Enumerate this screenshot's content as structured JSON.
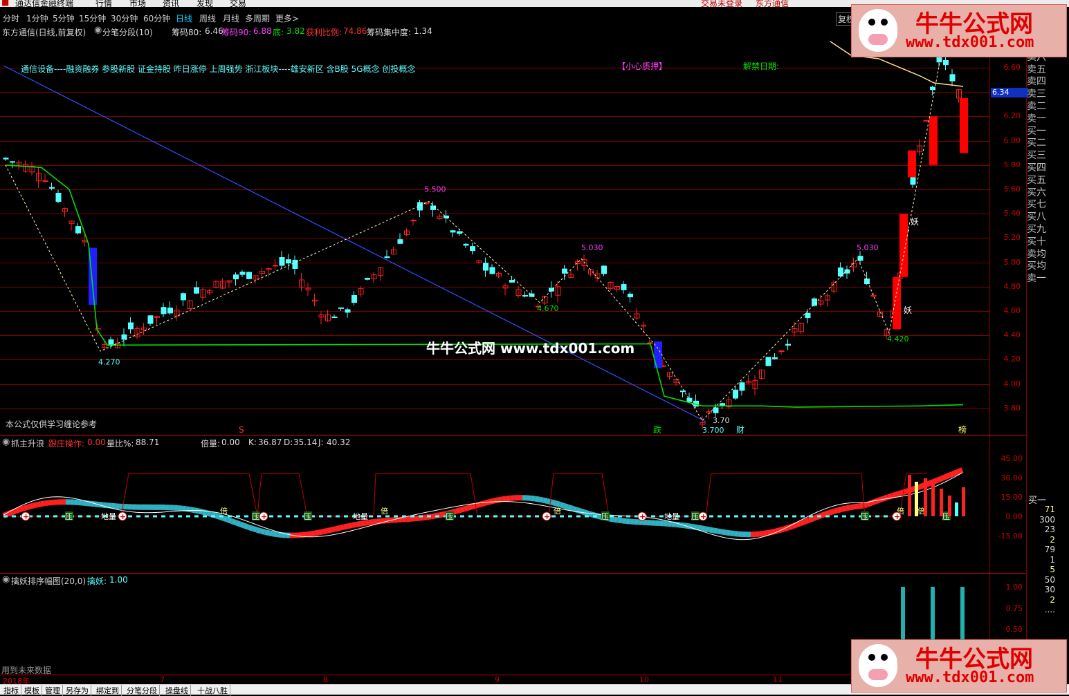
{
  "menu": {
    "app": "通达信金融终端",
    "items": [
      "行情",
      "市场",
      "资讯",
      "发现",
      "交易"
    ],
    "login": "交易未登录",
    "stock": "东方通信"
  },
  "periods": [
    "分时",
    "1分钟",
    "5分钟",
    "15分钟",
    "30分钟",
    "60分钟",
    "日线",
    "周线",
    "月线",
    "多周期",
    "更多>"
  ],
  "active_period": "日线",
  "restore_button": "复权",
  "main_panel": {
    "stock_title": "东方通信(日线,前复权)",
    "indicator_name": "分笔分段(10)",
    "chip80_label": "筹码80:",
    "chip80": "6.46",
    "chip90_label": "筹码90:",
    "chip90": "6.88",
    "bottom_label": "底:",
    "bottom": "3.82",
    "profit_label": "获利比例:",
    "profit": "74.86",
    "conc_label": "筹码集中度:",
    "conc": "1.34",
    "concepts": "通信设备----融资融券 参股新股 证金持股 昨日涨停 上周强势 浙江板块----雄安新区 含B股 5G概念 创投概念",
    "warning": "【小心质押】",
    "unlock": "解禁日期:",
    "note": "本公式仅供学习缠论参考",
    "watermark": "牛牛公式网 www.tdx001.com",
    "current_price": "6.34",
    "pivot_labels": [
      "4.270",
      "5.500",
      "4.670",
      "5.030",
      "3.70",
      "3.700",
      "5.030",
      "4.420"
    ],
    "markers": {
      "s": "S",
      "die": "跌",
      "cai": "财",
      "bang": "榜",
      "yao": "妖"
    }
  },
  "price_axis": [
    "6.60",
    "6.40",
    "6.20",
    "6.00",
    "5.80",
    "5.60",
    "5.40",
    "5.20",
    "5.00",
    "4.80",
    "4.60",
    "4.40",
    "4.20",
    "4.00",
    "3.80"
  ],
  "order_book": [
    "卖七",
    "卖六",
    "卖五",
    "卖四",
    "卖三",
    "卖二",
    "卖一",
    "买一",
    "买二",
    "买三",
    "买四",
    "买五",
    "买六",
    "买七",
    "买八",
    "买九",
    "买十",
    "卖均",
    "买均",
    "卖一"
  ],
  "mid_panel": {
    "title": "抓主升浪",
    "op_label": "跟庄操作:",
    "op": "0.00",
    "vol_label": "量比%:",
    "vol": "88.71",
    "bei_label": "倍量:",
    "bei": "0.00",
    "k_label": "K:",
    "k": "36.87",
    "d_label": "D:",
    "d": "35.14",
    "j_label": "J:",
    "j": "40.32",
    "axis": [
      "45.00",
      "30.00",
      "15.00",
      "0.00",
      "-15.00"
    ],
    "tags": {
      "ya": "压",
      "bei": "倍",
      "dl": "地量"
    },
    "buy1": "买一",
    "ticks": [
      "71",
      "300",
      "23",
      "2",
      "79",
      "1",
      "5",
      "50",
      "30",
      "2",
      "...."
    ]
  },
  "low_panel": {
    "title": "擒妖排序幅图(20,0)",
    "val_label": "擒妖:",
    "val": "1.00",
    "axis": [
      "1.00",
      "0.75",
      "0.50"
    ]
  },
  "future_note": "用到未来数据",
  "date_axis": [
    "2018年",
    "7",
    "8",
    "9",
    "10",
    "11"
  ],
  "bottom_tabs": [
    "指标",
    "模板",
    "管理",
    "另存为",
    "绑定到",
    "分笔分段",
    "操盘线",
    "十战八胜"
  ],
  "logo": {
    "cn": "牛牛公式网",
    "url": "www.tdx001.com"
  },
  "colors": {
    "up": "#ff2020",
    "down": "#54ffff",
    "grid": "#800000",
    "ma": "#00e000",
    "trend": "#3050ff"
  }
}
